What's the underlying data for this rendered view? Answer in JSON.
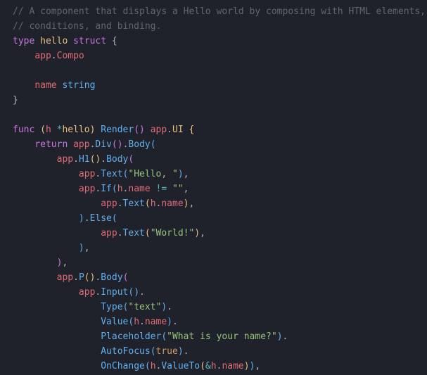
{
  "code": {
    "c1": "// A component that displays a Hello world by composing with HTML elements,",
    "c2": "// conditions, and binding.",
    "kw_type": "type",
    "name_hello": "hello",
    "kw_struct": "struct",
    "lb_open1": "{",
    "id_app": "app",
    "dot": ".",
    "id_Compo": "Compo",
    "id_name": "name",
    "tn_string": "string",
    "rb_close1": "}",
    "kw_func": "func",
    "lp": "(",
    "rp": ")",
    "id_h": "h",
    "star": "*",
    "fn_Render": "Render",
    "id_UI": "UI",
    "kw_return": "return",
    "fn_Div": "Div",
    "fn_Body": "Body",
    "fn_H1": "H1",
    "fn_Text": "Text",
    "str_hello": "\"Hello, \"",
    "fn_If": "If",
    "op_neq": "!=",
    "str_empty": "\"\"",
    "comma": ",",
    "fn_Else": "Else",
    "str_world": "\"World!\"",
    "fn_P": "P",
    "fn_Input": "Input",
    "fn_Type": "Type",
    "str_text": "\"text\"",
    "fn_Value": "Value",
    "fn_Placeholder": "Placeholder",
    "str_prompt": "\"What is your name?\"",
    "fn_AutoFocus": "AutoFocus",
    "lit_true": "true",
    "fn_OnChange": "OnChange",
    "fn_ValueTo": "ValueTo",
    "amp": "&"
  }
}
